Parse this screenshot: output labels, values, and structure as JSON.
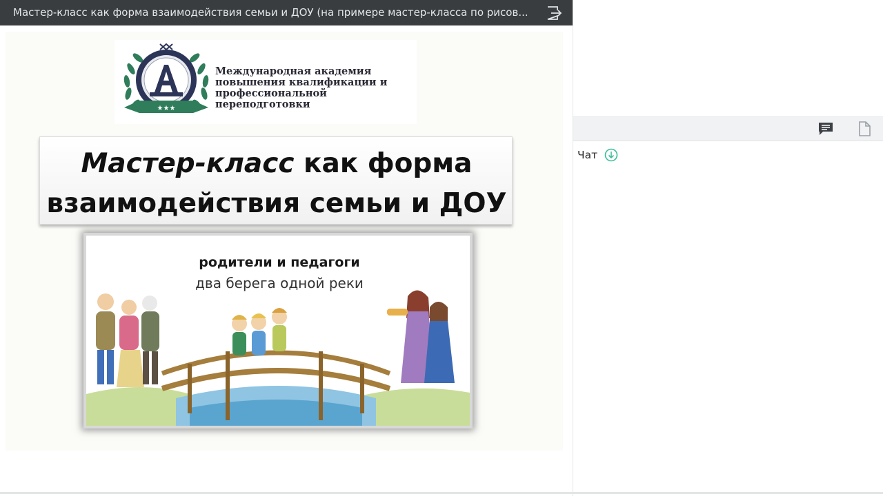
{
  "header": {
    "title": "Мастер-класс как форма взаимодействия семьи и ДОУ (на примере мастер-класса по рисов...",
    "exit_icon": "exit-icon"
  },
  "slide": {
    "logo": {
      "emblem_letter": "A",
      "org_lines": [
        "Международная академия",
        "повышения квалификации и",
        "профессиональной переподготовки"
      ]
    },
    "headline_italic": "Мастер-класс",
    "headline_rest1": " как форма",
    "headline_line2": "взаимодействия семьи и ДОУ",
    "image_caption_1": "родители и педагоги",
    "image_caption_2": "два берега одной реки"
  },
  "chat": {
    "label": "Чат",
    "toolbar_icons": [
      "chat-icon",
      "document-icon"
    ],
    "download_icon": "download-icon",
    "accent": "#3bbf9a"
  }
}
